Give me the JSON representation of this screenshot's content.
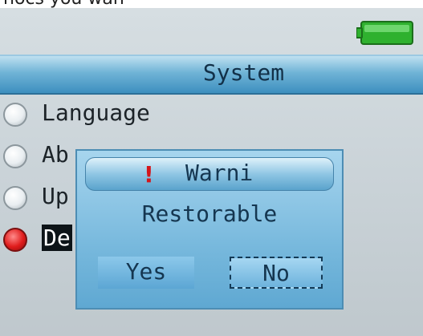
{
  "top_cutoff_text": "nocs you wan",
  "header": {
    "title": "System"
  },
  "menu": {
    "items": [
      {
        "label": "Language",
        "selected": false
      },
      {
        "label": "Ab",
        "selected": false
      },
      {
        "label": "Up",
        "selected": false
      },
      {
        "label": "De",
        "selected": true
      }
    ]
  },
  "dialog": {
    "title": "Warni",
    "message": "Restorable",
    "yes_label": "Yes",
    "no_label": "No"
  },
  "colors": {
    "title_bar": "#6fb3d6",
    "dialog_bg": "#78b9dd",
    "battery": "#2fb12f",
    "warning": "#d4161b",
    "selected_radio": "#e01c1c"
  },
  "icons": {
    "battery": "battery-full-icon",
    "warning": "exclamation-icon"
  }
}
